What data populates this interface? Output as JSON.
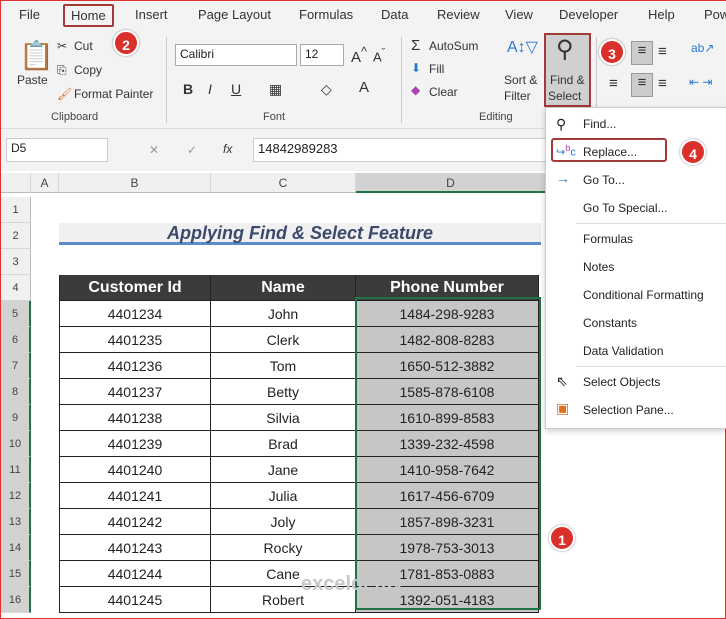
{
  "tabs": [
    "File",
    "Home",
    "Insert",
    "Page Layout",
    "Formulas",
    "Data",
    "Review",
    "View",
    "Developer",
    "Help",
    "Pow"
  ],
  "ribbon": {
    "paste": "Paste",
    "cut": "Cut",
    "copy": "Copy",
    "format_painter": "Format Painter",
    "clipboard": "Clipboard",
    "font_name": "Calibri",
    "font_size": "12",
    "font": "Font",
    "autosum": "AutoSum",
    "fill": "Fill",
    "clear": "Clear",
    "sort_filter_1": "Sort &",
    "sort_filter_2": "Filter",
    "find_select_1": "Find &",
    "find_select_2": "Select",
    "editing": "Editing",
    "bold": "B",
    "italic": "I",
    "underline": "U"
  },
  "formula_bar": {
    "name_box": "D5",
    "fx": "fx",
    "value": "14842989283"
  },
  "columns": [
    "A",
    "B",
    "C",
    "D"
  ],
  "rows": [
    "1",
    "2",
    "3",
    "4",
    "5",
    "6",
    "7",
    "8",
    "9",
    "10",
    "11",
    "12",
    "13",
    "14",
    "15",
    "16"
  ],
  "sheet": {
    "title": "Applying Find & Select Feature",
    "headers": [
      "Customer Id",
      "Name",
      "Phone Number"
    ],
    "data": [
      [
        "4401234",
        "John",
        "1484-298-9283"
      ],
      [
        "4401235",
        "Clerk",
        "1482-808-8283"
      ],
      [
        "4401236",
        "Tom",
        "1650-512-3882"
      ],
      [
        "4401237",
        "Betty",
        "1585-878-6108"
      ],
      [
        "4401238",
        "Silvia",
        "1610-899-8583"
      ],
      [
        "4401239",
        "Brad",
        "1339-232-4598"
      ],
      [
        "4401240",
        "Jane",
        "1410-958-7642"
      ],
      [
        "4401241",
        "Julia",
        "1617-456-6709"
      ],
      [
        "4401242",
        "Joly",
        "1857-898-3231"
      ],
      [
        "4401243",
        "Rocky",
        "1978-753-3013"
      ],
      [
        "4401244",
        "Cane",
        "1781-853-0883"
      ],
      [
        "4401245",
        "Robert",
        "1392-051-4183"
      ]
    ]
  },
  "menu": {
    "find": "Find...",
    "replace": "Replace...",
    "goto": "Go To...",
    "goto_special": "Go To Special...",
    "formulas": "Formulas",
    "notes": "Notes",
    "conditional_formatting": "Conditional Formatting",
    "constants": "Constants",
    "data_validation": "Data Validation",
    "select_objects": "Select Objects",
    "selection_pane": "Selection Pane..."
  },
  "badges": [
    "1",
    "2",
    "3",
    "4"
  ],
  "watermark": "exceldemy",
  "colors": {
    "highlight": "#a33a3a",
    "badge": "#d9302c",
    "header_fill": "#3b3b3b",
    "selected_fill": "#c6c6c6",
    "title": "#3b4a6b"
  }
}
